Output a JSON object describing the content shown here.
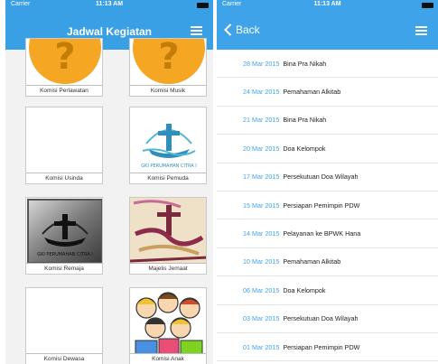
{
  "status": {
    "left_carrier": "Carrier",
    "left_time": "11:13 AM",
    "right_carrier": "Carrier",
    "right_time": "11:13 AM"
  },
  "left_screen": {
    "title": "Jadwal Kegiatan",
    "tiles": [
      {
        "label": "Komisi Perlawatan",
        "icon": "question-icon"
      },
      {
        "label": "Komisi Musik",
        "icon": "question-icon"
      },
      {
        "label": "Komisi Usinda",
        "icon": "blank"
      },
      {
        "label": "Komisi Pemuda",
        "icon": "church-logo-icon",
        "logo_text": "GKI PERUMAHAN CITRA I"
      },
      {
        "label": "Komisi Remaja",
        "icon": "church-logo-gray-icon",
        "logo_text": "GKI PERUMAHAN CITRA I"
      },
      {
        "label": "Majelis Jemaat",
        "icon": "cross-art-icon"
      },
      {
        "label": "Komisi Dewasa",
        "icon": "blank"
      },
      {
        "label": "Komisi Anak",
        "icon": "children-icon"
      }
    ]
  },
  "right_screen": {
    "back_label": "Back",
    "events": [
      {
        "date": "28 Mar 2015",
        "title": "Bina Pra Nikah"
      },
      {
        "date": "24 Mar 2015",
        "title": "Pemahaman Alkitab"
      },
      {
        "date": "21 Mar 2015",
        "title": "Bina Pra Nikah"
      },
      {
        "date": "20 Mar 2015",
        "title": "Doa Kelompok"
      },
      {
        "date": "17 Mar 2015",
        "title": "Persekutuan Doa Wilayah"
      },
      {
        "date": "15 Mar 2015",
        "title": "Persiapan Pemimpin PDW"
      },
      {
        "date": "14 Mar 2015",
        "title": "Pelayanan ke BPWK Hana"
      },
      {
        "date": "10 Mar 2015",
        "title": "Pemahaman Alkitab"
      },
      {
        "date": "06 Mar 2015",
        "title": "Doa Kelompok"
      },
      {
        "date": "03 Mar 2015",
        "title": "Persekutuan Doa Wilayah"
      },
      {
        "date": "01 Mar 2015",
        "title": "Persiapan Pemimpin PDW"
      }
    ]
  },
  "colors": {
    "navbar": "#3ea3e8",
    "date_text": "#3ea3e8",
    "question_orange": "#f5a623"
  }
}
